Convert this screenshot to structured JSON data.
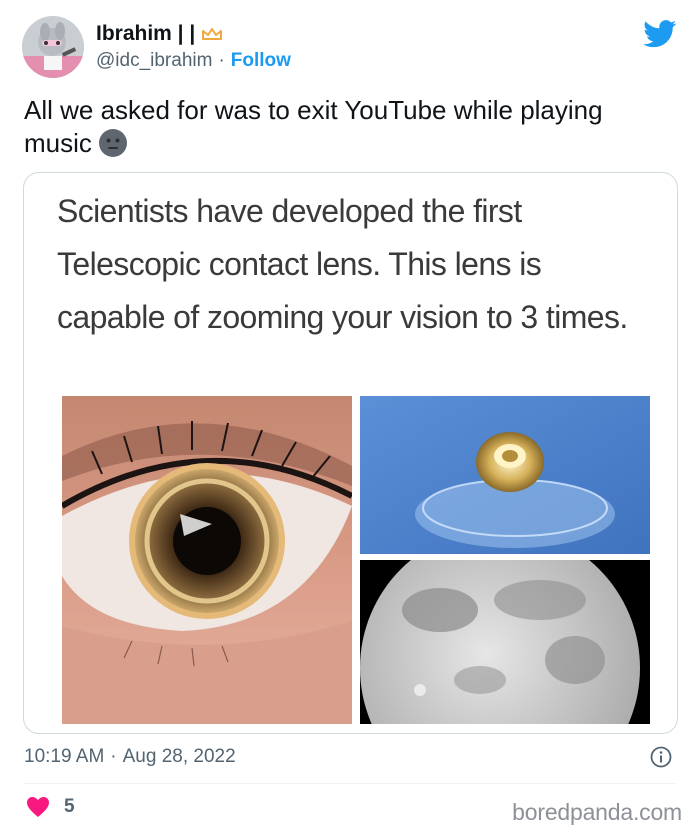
{
  "user": {
    "display_name": "Ibrahim | |",
    "handle": "@idc_ibrahim",
    "follow_label": "Follow",
    "handle_separator": "·"
  },
  "icons": {
    "brand": "twitter-bird-icon",
    "badge": "crown-icon",
    "emoji": "neutral-face-emoji",
    "info": "info-icon",
    "like": "heart-icon"
  },
  "tweet": {
    "text": "All we asked for was to exit YouTube while playing music",
    "media_caption": "Scientists have developed the first Telescopic contact lens. This lens is capable of zooming your vision to 3 times."
  },
  "meta": {
    "time": "10:19 AM",
    "separator": "·",
    "date": "Aug 28, 2022",
    "like_count": "5"
  },
  "watermark": "boredpanda.com",
  "colors": {
    "accent": "#1d9bf0",
    "like": "#f91880",
    "badge": "#f2a93b",
    "text": "#0f1419",
    "muted": "#536471"
  }
}
